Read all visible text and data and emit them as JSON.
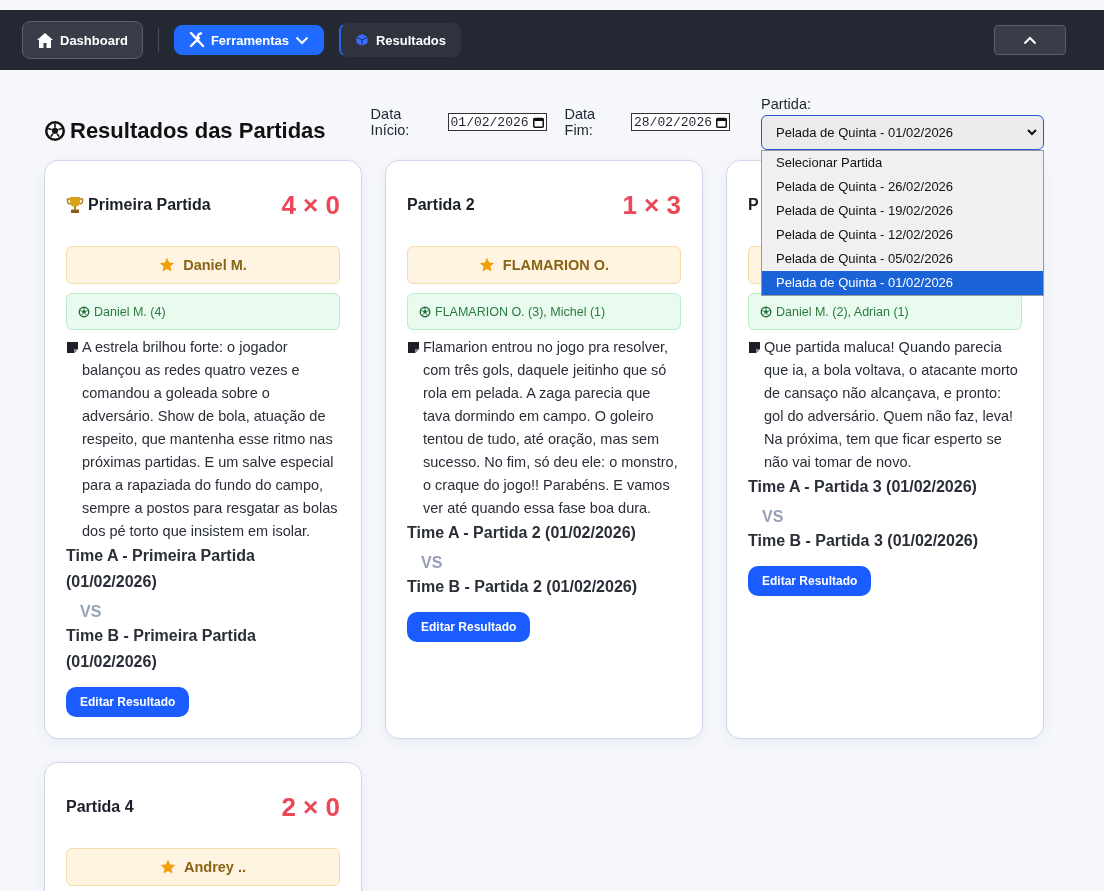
{
  "nav": {
    "items": [
      {
        "label": "Dashboard",
        "kind": "plain",
        "selected": false
      },
      {
        "label": "Ferramentas",
        "kind": "menu",
        "selected": false
      },
      {
        "label": "Resultados",
        "kind": "plain",
        "selected": true
      }
    ],
    "collapse_button": true
  },
  "page_title": "Resultados das Partidas",
  "filters": {
    "start_label": "Data Início:",
    "start_value": "01/02/2026",
    "end_label": "Data Fim:",
    "end_value": "28/02/2026",
    "match_label": "Partida:",
    "match_value": "Pelada de Quinta - 01/02/2026",
    "options": [
      {
        "label": "Selecionar Partida",
        "selected": false
      },
      {
        "label": "Pelada de Quinta - 26/02/2026",
        "selected": false
      },
      {
        "label": "Pelada de Quinta - 19/02/2026",
        "selected": false
      },
      {
        "label": "Pelada de Quinta - 12/02/2026",
        "selected": false
      },
      {
        "label": "Pelada de Quinta - 05/02/2026",
        "selected": false
      },
      {
        "label": "Pelada de Quinta - 01/02/2026",
        "selected": true
      }
    ]
  },
  "matches": [
    {
      "title": "Primeira Partida",
      "trophy": true,
      "score": "4 × 0",
      "mvp": "Daniel M.",
      "scorers": "Daniel M. (4)",
      "summary": "A estrela brilhou forte: o jogador balançou as redes quatro vezes e comandou a goleada sobre o adversário. Show de bola, atuação de respeito, que mantenha esse ritmo nas próximas partidas. E um salve especial para a rapaziada do fundo do campo, sempre a postos para resgatar as bolas dos pé torto que insistem em isolar.",
      "team_a": "Time A - Primeira Partida (01/02/2026)",
      "vs": "VS",
      "team_b": "Time B - Primeira Partida (01/02/2026)",
      "button": "Editar Resultado"
    },
    {
      "title": "Partida 2",
      "trophy": false,
      "score": "1 × 3",
      "mvp": "FLAMARION O.",
      "scorers": "FLAMARION O. (3), Michel (1)",
      "summary": "Flamarion entrou no jogo pra resolver, com três gols, daquele jeitinho que só rola em pelada. A zaga parecia que tava dormindo em campo. O goleiro tentou de tudo, até oração, mas sem sucesso. No fim, só deu ele: o monstro, o craque do jogo!! Parabéns. E vamos ver até quando essa fase boa dura.",
      "team_a": "Time A - Partida 2 (01/02/2026)",
      "vs": "VS",
      "team_b": "Time B - Partida 2 (01/02/2026)",
      "button": "Editar Resultado"
    },
    {
      "title": "P",
      "trophy": false,
      "scorers": "Daniel M. (2), Adrian (1)",
      "summary": "Que partida maluca! Quando parecia que ia, a bola voltava, o atacante morto de cansaço não alcançava, e pronto: gol do adversário. Quem não faz, leva! Na próxima, tem que ficar esperto se não vai tomar de novo.",
      "team_a": "Time A - Partida 3 (01/02/2026)",
      "vs": "VS",
      "team_b": "Time B - Partida 3 (01/02/2026)",
      "button": "Editar Resultado"
    },
    {
      "title": "Partida 4",
      "trophy": false,
      "score": "2 × 0",
      "mvp": "Andrey .."
    }
  ]
}
